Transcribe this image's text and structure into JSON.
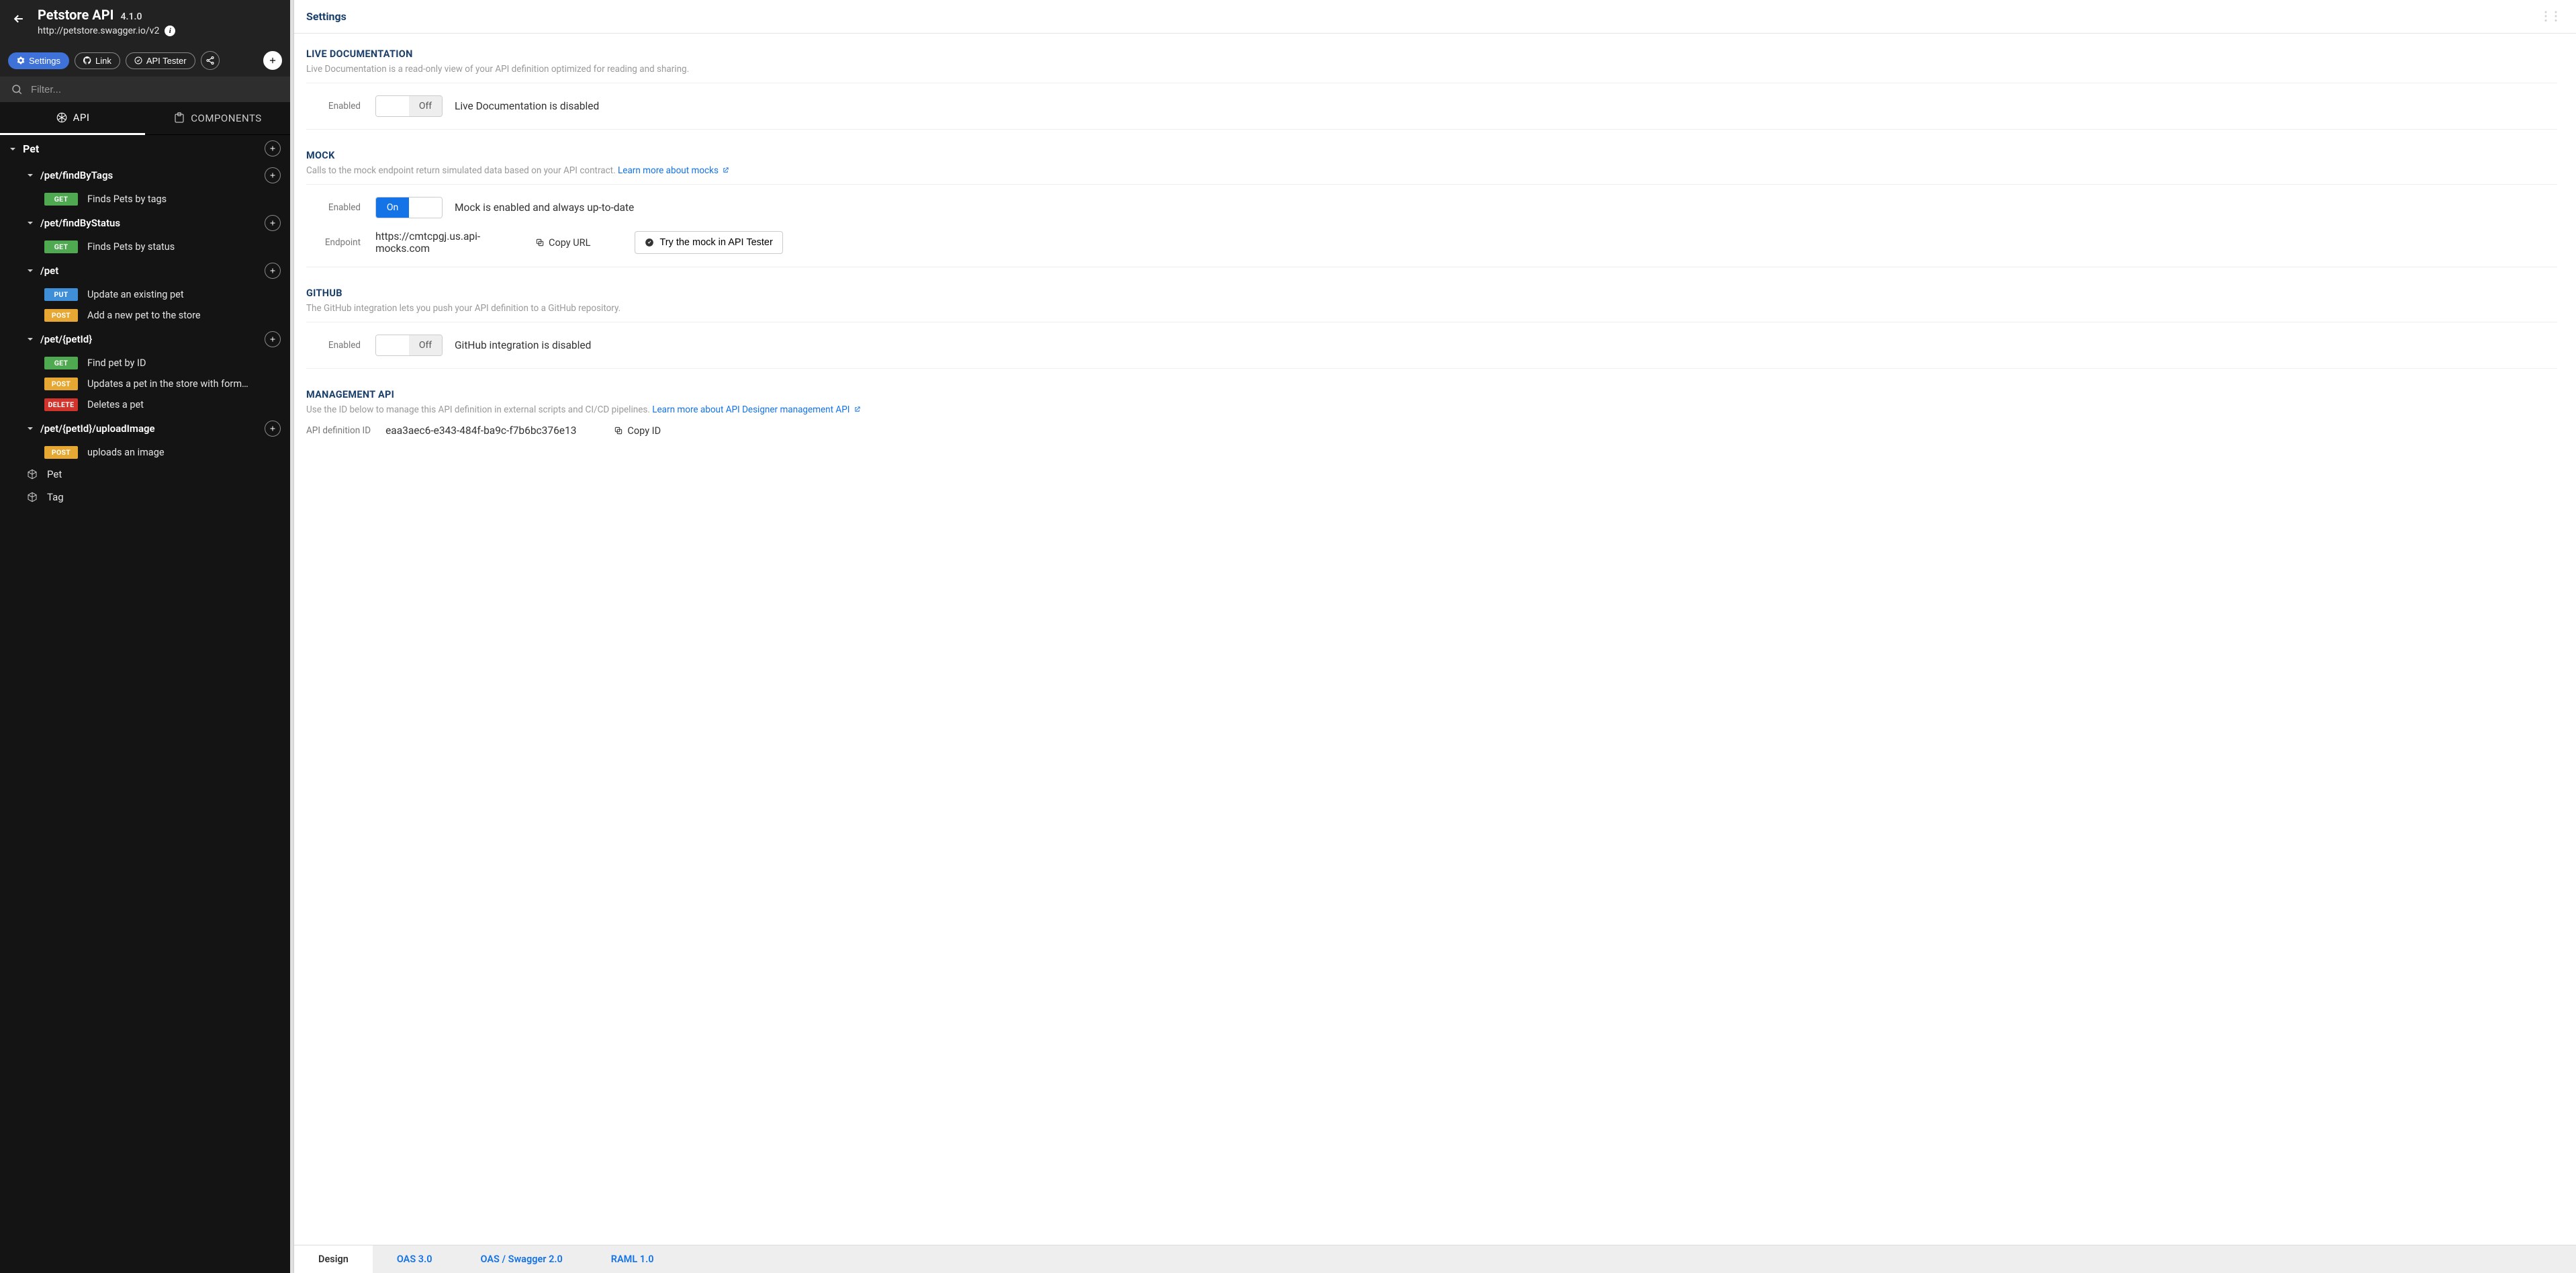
{
  "header": {
    "title": "Petstore API",
    "version": "4.1.0",
    "url": "http://petstore.swagger.io/v2"
  },
  "toolbar": {
    "settings": "Settings",
    "link": "Link",
    "api_tester": "API Tester"
  },
  "filter": {
    "placeholder": "Filter..."
  },
  "tabs": {
    "api": "API",
    "components": "COMPONENTS"
  },
  "tree": {
    "group": "Pet",
    "paths": [
      {
        "path": "/pet/findByTags",
        "ops": [
          {
            "method": "GET",
            "summary": "Finds Pets by tags"
          }
        ]
      },
      {
        "path": "/pet/findByStatus",
        "ops": [
          {
            "method": "GET",
            "summary": "Finds Pets by status"
          }
        ]
      },
      {
        "path": "/pet",
        "ops": [
          {
            "method": "PUT",
            "summary": "Update an existing pet"
          },
          {
            "method": "POST",
            "summary": "Add a new pet to the store"
          }
        ]
      },
      {
        "path": "/pet/{petId}",
        "ops": [
          {
            "method": "GET",
            "summary": "Find pet by ID"
          },
          {
            "method": "POST",
            "summary": "Updates a pet in the store with form…"
          },
          {
            "method": "DELETE",
            "summary": "Deletes a pet"
          }
        ]
      },
      {
        "path": "/pet/{petId}/uploadImage",
        "ops": [
          {
            "method": "POST",
            "summary": "uploads an image"
          }
        ]
      }
    ],
    "schemas": [
      "Pet",
      "Tag"
    ]
  },
  "settings": {
    "title": "Settings",
    "live_doc": {
      "heading": "LIVE DOCUMENTATION",
      "desc": "Live Documentation is a read-only view of your API definition optimized for reading and sharing.",
      "enabled_label": "Enabled",
      "toggle_state": "off",
      "toggle_text": "Off",
      "status": "Live Documentation is disabled"
    },
    "mock": {
      "heading": "MOCK",
      "desc_prefix": "Calls to the mock endpoint return simulated data based on your API contract. ",
      "desc_link": "Learn more about mocks",
      "enabled_label": "Enabled",
      "toggle_state": "on",
      "toggle_text": "On",
      "status": "Mock is enabled and always up-to-date",
      "endpoint_label": "Endpoint",
      "endpoint_value": "https://cmtcpgj.us.api-mocks.com",
      "copy_url": "Copy URL",
      "try_mock": "Try the mock in API Tester"
    },
    "github": {
      "heading": "GITHUB",
      "desc": "The GitHub integration lets you push your API definition to a GitHub repository.",
      "enabled_label": "Enabled",
      "toggle_state": "off",
      "toggle_text": "Off",
      "status": "GitHub integration is disabled"
    },
    "mgmt": {
      "heading": "MANAGEMENT API",
      "desc_prefix": "Use the ID below to manage this API definition in external scripts and CI/CD pipelines. ",
      "desc_link": "Learn more about API Designer management API",
      "id_label": "API definition ID",
      "id_value": "eaa3aec6-e343-484f-ba9c-f7b6bc376e13",
      "copy_id": "Copy ID"
    }
  },
  "bottom_tabs": {
    "design": "Design",
    "oas3": "OAS 3.0",
    "oas2": "OAS / Swagger 2.0",
    "raml": "RAML 1.0"
  }
}
